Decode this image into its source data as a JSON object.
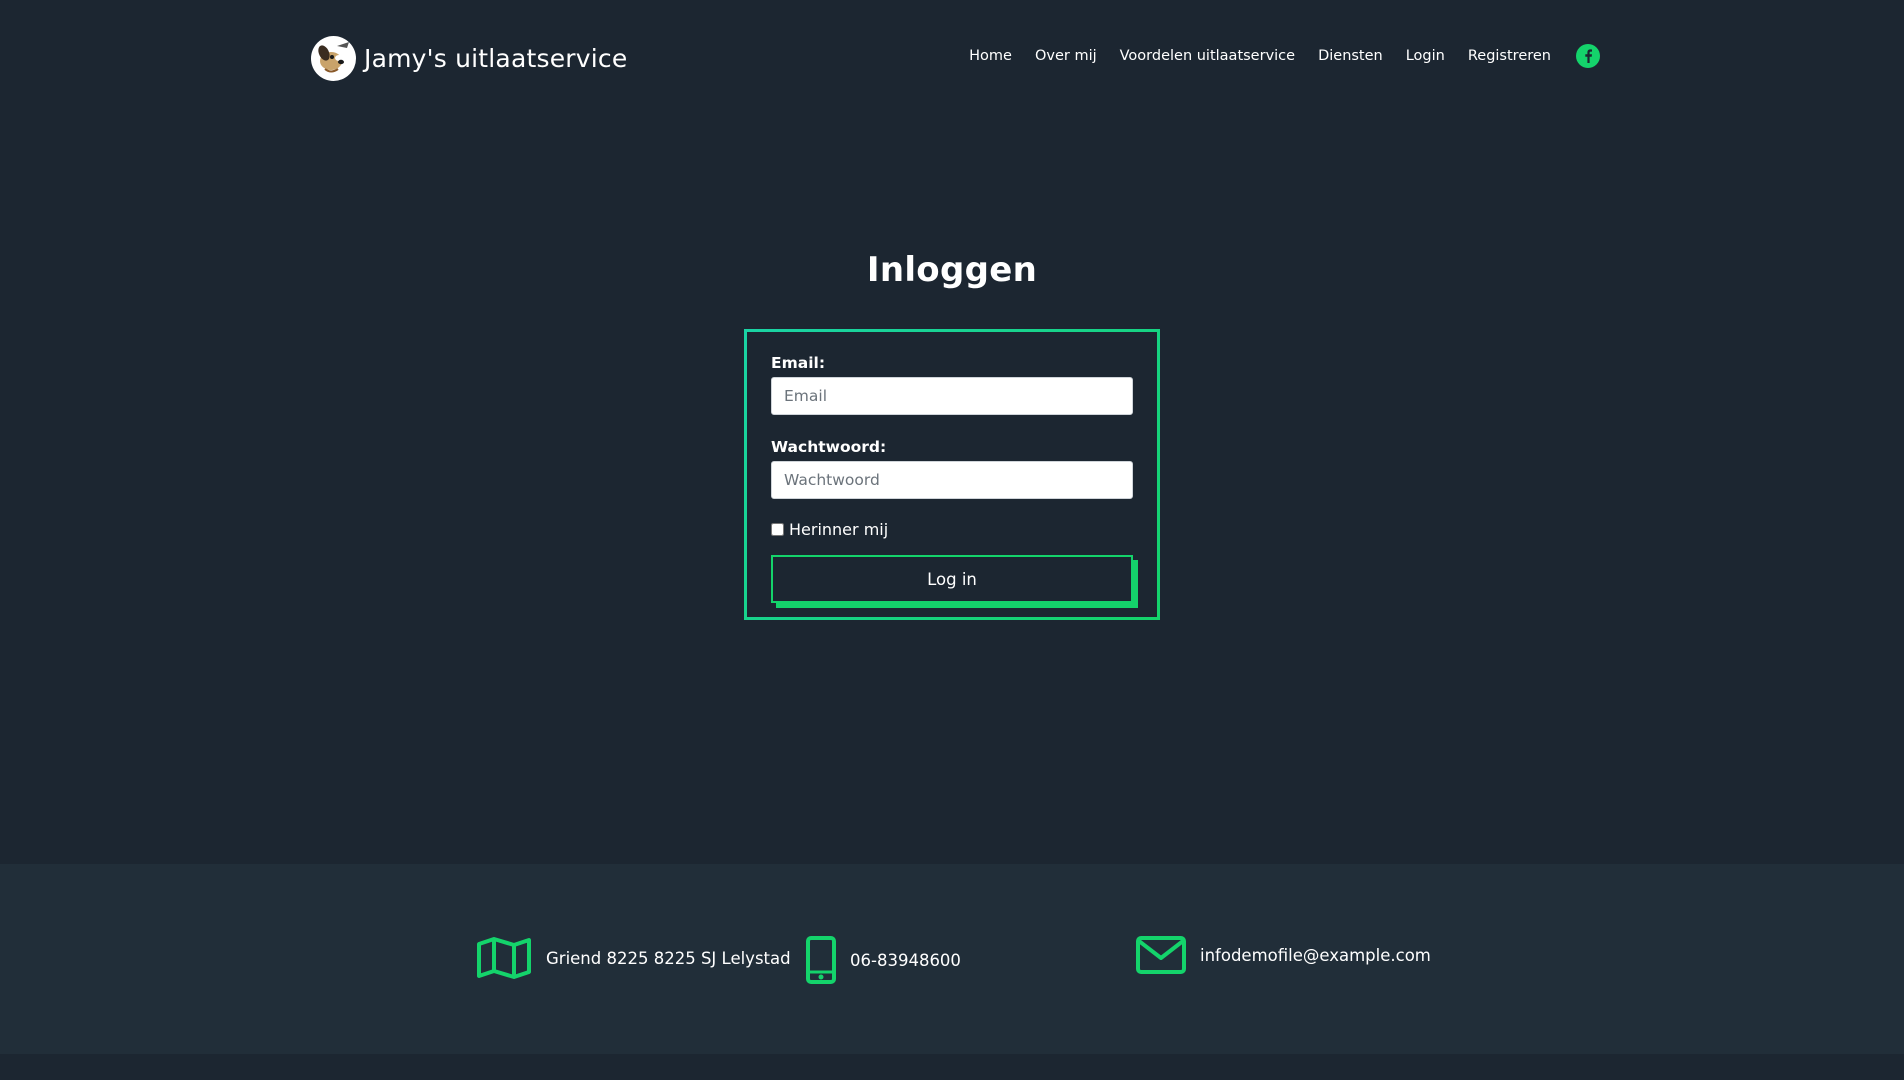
{
  "header": {
    "brand": "Jamy's uitlaatservice",
    "nav": [
      "Home",
      "Over mij",
      "Voordelen uitlaatservice",
      "Diensten",
      "Login",
      "Registreren"
    ]
  },
  "login": {
    "title": "Inloggen",
    "email_label": "Email:",
    "email_placeholder": "Email",
    "password_label": "Wachtwoord:",
    "password_placeholder": "Wachtwoord",
    "remember_label": "Herinner mij",
    "remember_checked": false,
    "submit_label": "Log in"
  },
  "footer": {
    "address": "Griend 8225 8225 SJ Lelystad",
    "phone": "06-83948600",
    "email": "infodemofile@example.com"
  },
  "colors": {
    "background": "#1c2631",
    "footer": "#212e39",
    "accent": "#14d36b",
    "accent_teal": "#1ad3a4"
  }
}
